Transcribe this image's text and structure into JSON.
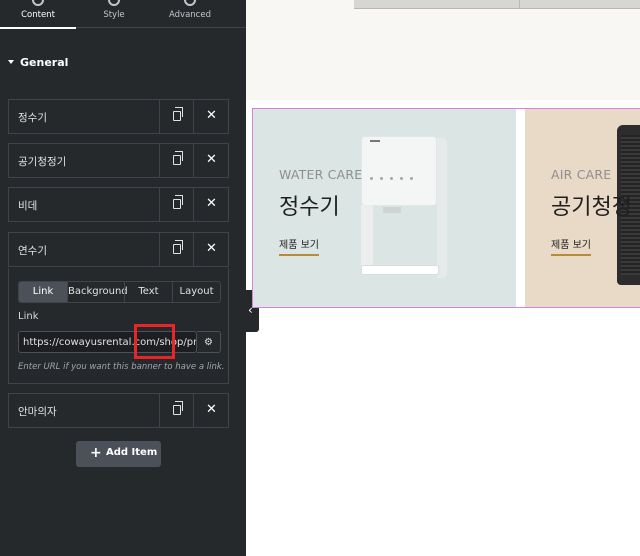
{
  "tabs": [
    {
      "label": "Content",
      "icon": "pencil-icon",
      "active": true
    },
    {
      "label": "Style",
      "icon": "half-circle-icon",
      "active": false
    },
    {
      "label": "Advanced",
      "icon": "gear-icon",
      "active": false
    }
  ],
  "section": {
    "title": "General"
  },
  "items": [
    {
      "title": "정수기"
    },
    {
      "title": "공기청정기"
    },
    {
      "title": "비데"
    },
    {
      "title": "연수기"
    },
    {
      "title": "안마의자"
    }
  ],
  "expanded": {
    "tabs": [
      "Link",
      "Background",
      "Text",
      "Layout"
    ],
    "link_label": "Link",
    "url_value": "https://cowayusrental.com/shop/product",
    "help_text": "Enter URL if you want this banner to have a link."
  },
  "add_button": {
    "label": "Add Item"
  },
  "banners": [
    {
      "subtitle": "WATER CARE",
      "title": "정수기",
      "link": "제품 보기"
    },
    {
      "subtitle": "AIR CARE",
      "title": "공기청정",
      "link": "제품 보기"
    }
  ],
  "colors": {
    "panel_bg": "#26292c",
    "highlight": "#e8262a",
    "water_banner": "#dbe5e4",
    "air_banner": "#e9d9c7",
    "link_underline": "#b88b3a",
    "section_outline": "#d383d9"
  }
}
